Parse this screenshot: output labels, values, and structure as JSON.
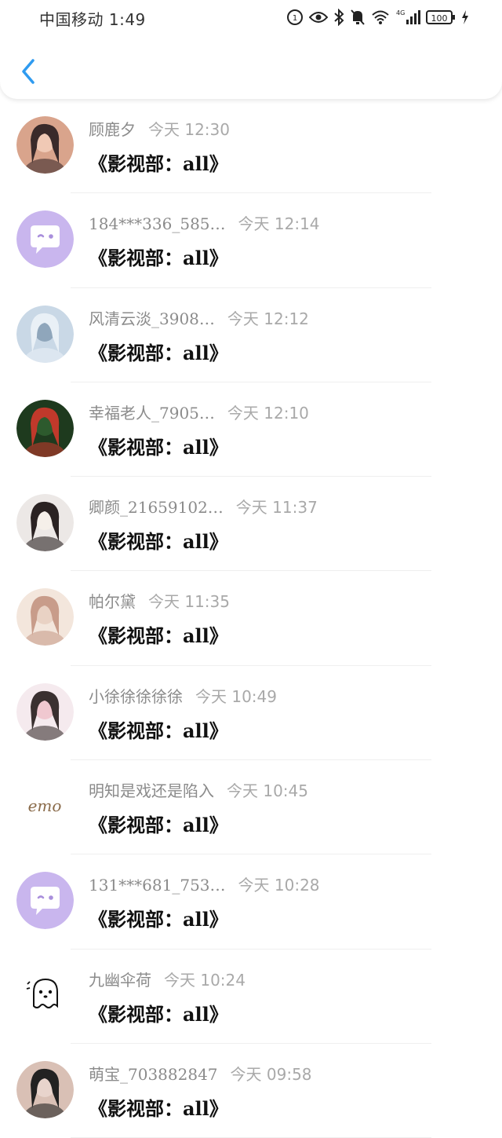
{
  "status_bar": {
    "carrier_time": "中国移动 1:49",
    "network": "4G",
    "battery": "100"
  },
  "nav": {
    "back_icon": "chevron-left-icon",
    "accent": "#2f9bf0"
  },
  "messages": [
    {
      "name": "顾鹿夕",
      "time": "今天 12:30",
      "text": "《影视部：all》",
      "avatar": "photo"
    },
    {
      "name": "184***336_585…",
      "time": "今天 12:14",
      "text": "《影视部：all》",
      "avatar": "default-chat"
    },
    {
      "name": "风清云淡_3908…",
      "time": "今天 12:12",
      "text": "《影视部：all》",
      "avatar": "photo"
    },
    {
      "name": "幸福老人_7905…",
      "time": "今天 12:10",
      "text": "《影视部：all》",
      "avatar": "photo"
    },
    {
      "name": "卿颜_21659102…",
      "time": "今天 11:37",
      "text": "《影视部：all》",
      "avatar": "photo"
    },
    {
      "name": "帕尔黛",
      "time": "今天 11:35",
      "text": "《影视部：all》",
      "avatar": "photo"
    },
    {
      "name": "小徐徐徐徐徐",
      "time": "今天 10:49",
      "text": "《影视部：all》",
      "avatar": "photo"
    },
    {
      "name": "明知是戏还是陷入",
      "time": "今天 10:45",
      "text": "《影视部：all》",
      "avatar": "emo"
    },
    {
      "name": "131***681_753…",
      "time": "今天 10:28",
      "text": "《影视部：all》",
      "avatar": "default-chat"
    },
    {
      "name": "九幽伞荷",
      "time": "今天 10:24",
      "text": "《影视部：all》",
      "avatar": "ghost"
    },
    {
      "name": "萌宝_703882847",
      "time": "今天 09:58",
      "text": "《影视部：all》",
      "avatar": "photo"
    }
  ]
}
